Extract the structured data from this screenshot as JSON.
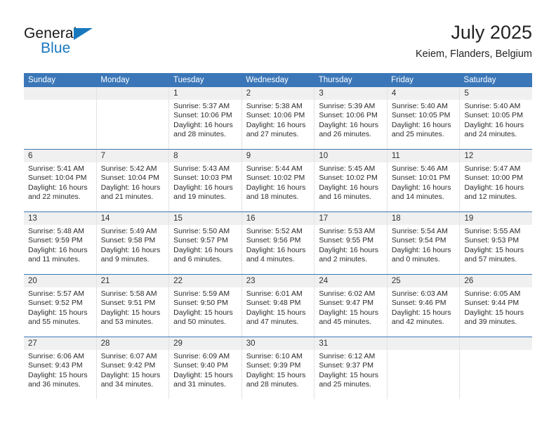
{
  "logo": {
    "word1": "General",
    "word2": "Blue",
    "triangle_color": "#1878be",
    "word1_color": "#1b1b1b",
    "word2_color": "#1878be"
  },
  "header": {
    "title": "July 2025",
    "subtitle": "Keiem, Flanders, Belgium"
  },
  "theme": {
    "header_blue": "#3b77b8",
    "numbers_band": "#f0f0f0",
    "cell_border": "#e3e3e3",
    "text": "#2b2b2b"
  },
  "weekdays": [
    "Sunday",
    "Monday",
    "Tuesday",
    "Wednesday",
    "Thursday",
    "Friday",
    "Saturday"
  ],
  "weeks": [
    {
      "days": [
        {
          "num": "",
          "lines": []
        },
        {
          "num": "",
          "lines": []
        },
        {
          "num": "1",
          "lines": [
            "Sunrise: 5:37 AM",
            "Sunset: 10:06 PM",
            "Daylight: 16 hours",
            "and 28 minutes."
          ]
        },
        {
          "num": "2",
          "lines": [
            "Sunrise: 5:38 AM",
            "Sunset: 10:06 PM",
            "Daylight: 16 hours",
            "and 27 minutes."
          ]
        },
        {
          "num": "3",
          "lines": [
            "Sunrise: 5:39 AM",
            "Sunset: 10:06 PM",
            "Daylight: 16 hours",
            "and 26 minutes."
          ]
        },
        {
          "num": "4",
          "lines": [
            "Sunrise: 5:40 AM",
            "Sunset: 10:05 PM",
            "Daylight: 16 hours",
            "and 25 minutes."
          ]
        },
        {
          "num": "5",
          "lines": [
            "Sunrise: 5:40 AM",
            "Sunset: 10:05 PM",
            "Daylight: 16 hours",
            "and 24 minutes."
          ]
        }
      ]
    },
    {
      "days": [
        {
          "num": "6",
          "lines": [
            "Sunrise: 5:41 AM",
            "Sunset: 10:04 PM",
            "Daylight: 16 hours",
            "and 22 minutes."
          ]
        },
        {
          "num": "7",
          "lines": [
            "Sunrise: 5:42 AM",
            "Sunset: 10:04 PM",
            "Daylight: 16 hours",
            "and 21 minutes."
          ]
        },
        {
          "num": "8",
          "lines": [
            "Sunrise: 5:43 AM",
            "Sunset: 10:03 PM",
            "Daylight: 16 hours",
            "and 19 minutes."
          ]
        },
        {
          "num": "9",
          "lines": [
            "Sunrise: 5:44 AM",
            "Sunset: 10:02 PM",
            "Daylight: 16 hours",
            "and 18 minutes."
          ]
        },
        {
          "num": "10",
          "lines": [
            "Sunrise: 5:45 AM",
            "Sunset: 10:02 PM",
            "Daylight: 16 hours",
            "and 16 minutes."
          ]
        },
        {
          "num": "11",
          "lines": [
            "Sunrise: 5:46 AM",
            "Sunset: 10:01 PM",
            "Daylight: 16 hours",
            "and 14 minutes."
          ]
        },
        {
          "num": "12",
          "lines": [
            "Sunrise: 5:47 AM",
            "Sunset: 10:00 PM",
            "Daylight: 16 hours",
            "and 12 minutes."
          ]
        }
      ]
    },
    {
      "days": [
        {
          "num": "13",
          "lines": [
            "Sunrise: 5:48 AM",
            "Sunset: 9:59 PM",
            "Daylight: 16 hours",
            "and 11 minutes."
          ]
        },
        {
          "num": "14",
          "lines": [
            "Sunrise: 5:49 AM",
            "Sunset: 9:58 PM",
            "Daylight: 16 hours",
            "and 9 minutes."
          ]
        },
        {
          "num": "15",
          "lines": [
            "Sunrise: 5:50 AM",
            "Sunset: 9:57 PM",
            "Daylight: 16 hours",
            "and 6 minutes."
          ]
        },
        {
          "num": "16",
          "lines": [
            "Sunrise: 5:52 AM",
            "Sunset: 9:56 PM",
            "Daylight: 16 hours",
            "and 4 minutes."
          ]
        },
        {
          "num": "17",
          "lines": [
            "Sunrise: 5:53 AM",
            "Sunset: 9:55 PM",
            "Daylight: 16 hours",
            "and 2 minutes."
          ]
        },
        {
          "num": "18",
          "lines": [
            "Sunrise: 5:54 AM",
            "Sunset: 9:54 PM",
            "Daylight: 16 hours",
            "and 0 minutes."
          ]
        },
        {
          "num": "19",
          "lines": [
            "Sunrise: 5:55 AM",
            "Sunset: 9:53 PM",
            "Daylight: 15 hours",
            "and 57 minutes."
          ]
        }
      ]
    },
    {
      "days": [
        {
          "num": "20",
          "lines": [
            "Sunrise: 5:57 AM",
            "Sunset: 9:52 PM",
            "Daylight: 15 hours",
            "and 55 minutes."
          ]
        },
        {
          "num": "21",
          "lines": [
            "Sunrise: 5:58 AM",
            "Sunset: 9:51 PM",
            "Daylight: 15 hours",
            "and 53 minutes."
          ]
        },
        {
          "num": "22",
          "lines": [
            "Sunrise: 5:59 AM",
            "Sunset: 9:50 PM",
            "Daylight: 15 hours",
            "and 50 minutes."
          ]
        },
        {
          "num": "23",
          "lines": [
            "Sunrise: 6:01 AM",
            "Sunset: 9:48 PM",
            "Daylight: 15 hours",
            "and 47 minutes."
          ]
        },
        {
          "num": "24",
          "lines": [
            "Sunrise: 6:02 AM",
            "Sunset: 9:47 PM",
            "Daylight: 15 hours",
            "and 45 minutes."
          ]
        },
        {
          "num": "25",
          "lines": [
            "Sunrise: 6:03 AM",
            "Sunset: 9:46 PM",
            "Daylight: 15 hours",
            "and 42 minutes."
          ]
        },
        {
          "num": "26",
          "lines": [
            "Sunrise: 6:05 AM",
            "Sunset: 9:44 PM",
            "Daylight: 15 hours",
            "and 39 minutes."
          ]
        }
      ]
    },
    {
      "days": [
        {
          "num": "27",
          "lines": [
            "Sunrise: 6:06 AM",
            "Sunset: 9:43 PM",
            "Daylight: 15 hours",
            "and 36 minutes."
          ]
        },
        {
          "num": "28",
          "lines": [
            "Sunrise: 6:07 AM",
            "Sunset: 9:42 PM",
            "Daylight: 15 hours",
            "and 34 minutes."
          ]
        },
        {
          "num": "29",
          "lines": [
            "Sunrise: 6:09 AM",
            "Sunset: 9:40 PM",
            "Daylight: 15 hours",
            "and 31 minutes."
          ]
        },
        {
          "num": "30",
          "lines": [
            "Sunrise: 6:10 AM",
            "Sunset: 9:39 PM",
            "Daylight: 15 hours",
            "and 28 minutes."
          ]
        },
        {
          "num": "31",
          "lines": [
            "Sunrise: 6:12 AM",
            "Sunset: 9:37 PM",
            "Daylight: 15 hours",
            "and 25 minutes."
          ]
        },
        {
          "num": "",
          "lines": []
        },
        {
          "num": "",
          "lines": []
        }
      ]
    }
  ]
}
